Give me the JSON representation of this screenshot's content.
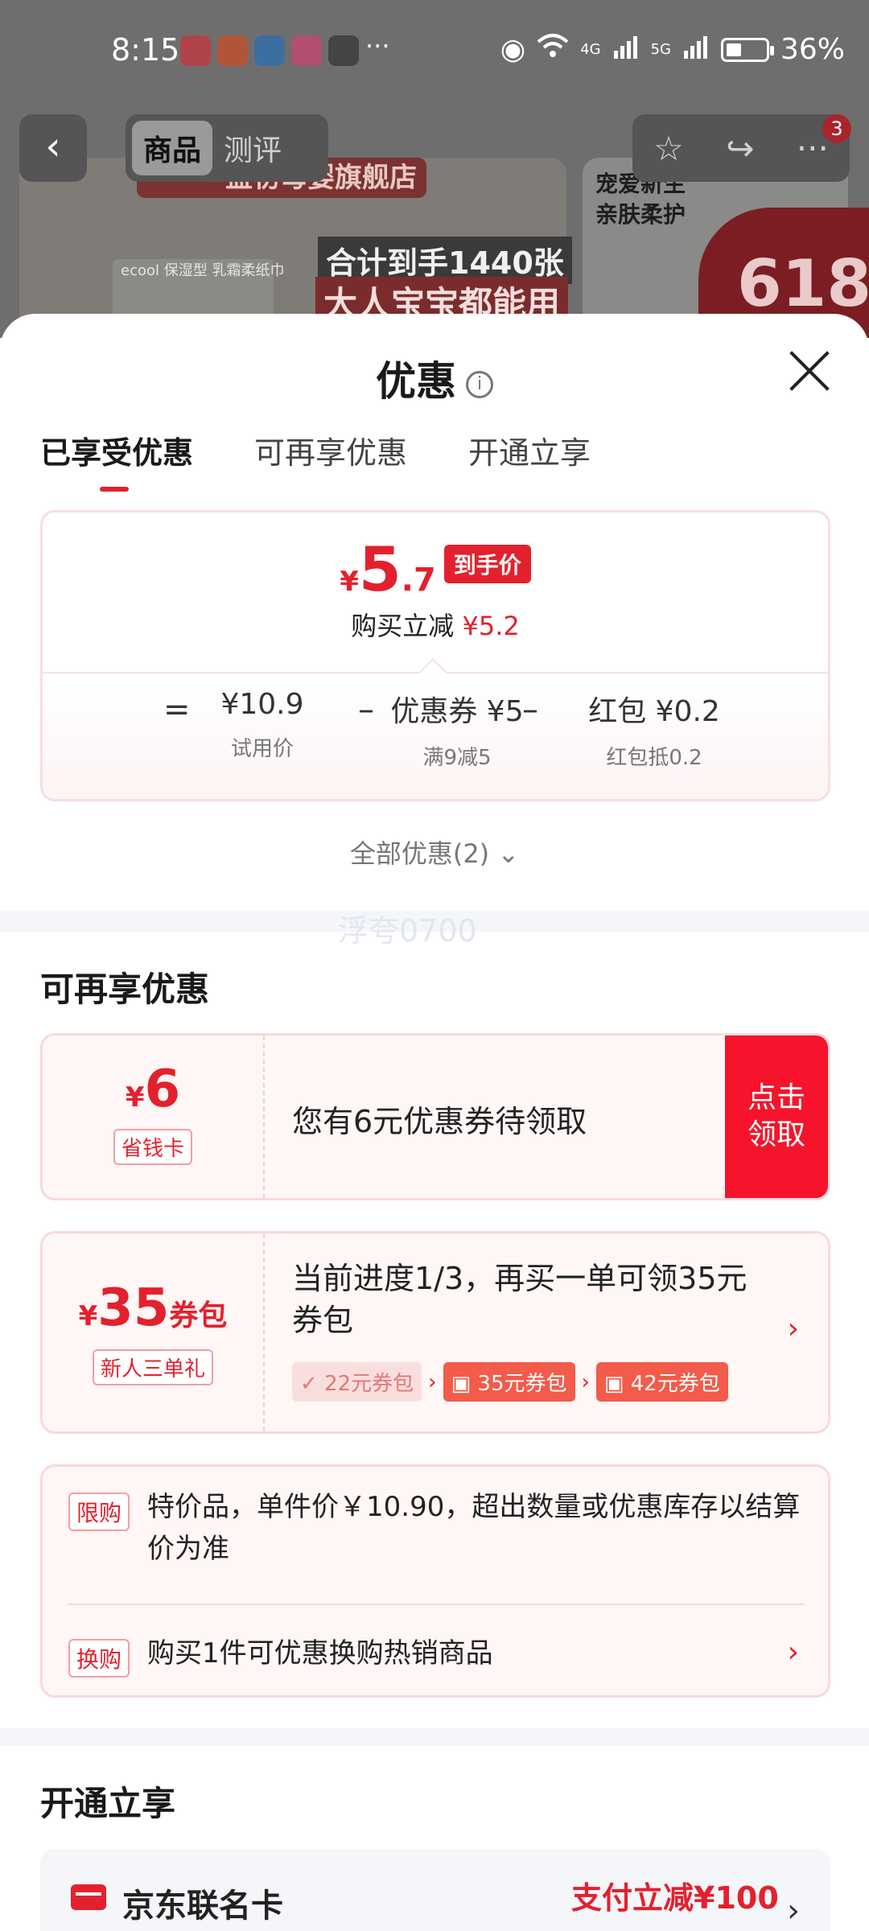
{
  "status_bar": {
    "time": "8:15",
    "more": "···",
    "battery": "36%",
    "network_1": "4G",
    "network_2": "5G"
  },
  "background_page": {
    "tabs": [
      "商品",
      "测评"
    ],
    "shop_tag": "益初母婴旗舰店",
    "slogan_1": "合计到手1440张",
    "slogan_2": "大人宝宝都能用",
    "product_text": "ecool 保湿型 乳霜柔纸巾",
    "side_text_1": "宠爱新生",
    "side_text_2": "亲肤柔护",
    "promo_number": "618",
    "badge_count": "3"
  },
  "sheet": {
    "title": "优惠",
    "tabs": [
      "已享受优惠",
      "可再享优惠",
      "开通立享"
    ]
  },
  "price_summary": {
    "currency": "¥",
    "price_int": "5",
    "price_dec": ".7",
    "final_tag": "到手价",
    "instant_cut_label": "购买立减",
    "instant_cut_value": "¥5.2",
    "equals": "=",
    "minus": "–",
    "items": [
      {
        "label": "¥10.9",
        "sub": "试用价"
      },
      {
        "label": "优惠券 ¥5",
        "sub": "满9减5"
      },
      {
        "label": "红包 ¥0.2",
        "sub": "红包抵0.2"
      }
    ],
    "all_discounts": "全部优惠(2)"
  },
  "watermark": "浮夸0700",
  "more_offers": {
    "title": "可再享优惠",
    "saver_card": {
      "currency": "¥",
      "amount": "6",
      "tag": "省钱卡",
      "text": "您有6元优惠券待领取",
      "button_line1": "点击",
      "button_line2": "领取"
    },
    "coupon_pack": {
      "currency": "¥",
      "amount": "35",
      "unit": "券包",
      "tag": "新人三单礼",
      "progress_text": "当前进度1/3，再买一单可领35元券包",
      "steps": [
        "22元券包",
        "35元券包",
        "42元券包"
      ]
    },
    "rules": [
      {
        "tag": "限购",
        "text": "特价品，单件价￥10.90，超出数量或优惠库存以结算价为准"
      },
      {
        "tag": "换购",
        "text": "购买1件可优惠换购热销商品"
      }
    ]
  },
  "open_enjoy": {
    "title": "开通立享",
    "card_name": "京东联名卡",
    "offer": "支付立减¥100"
  },
  "colors": {
    "accent": "#e3212e",
    "claim_button": "#f5142b",
    "chip_active": "#f35b4a"
  }
}
